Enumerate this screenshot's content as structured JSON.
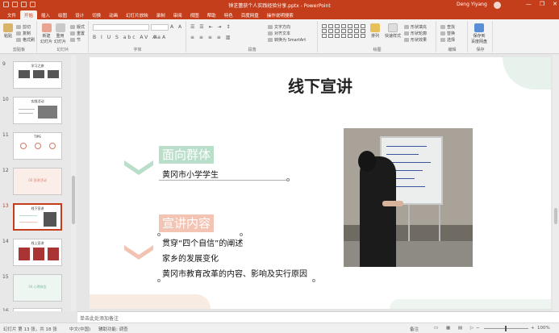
{
  "window": {
    "title": "钟芝蕾获个人实践经验分享.pptx  -  PowerPoint",
    "user": "Deng Yiyang",
    "min": "—",
    "restore": "❐",
    "close": "✕"
  },
  "tabs": [
    "文件",
    "开始",
    "插入",
    "绘图",
    "设计",
    "切换",
    "动画",
    "幻灯片放映",
    "录制",
    "审阅",
    "视图",
    "帮助",
    "特色",
    "百度网盘",
    "操作说明搜索"
  ],
  "ribbon": {
    "paste": "粘贴",
    "cut": "剪切",
    "copy": "复制",
    "format_painter": "格式刷",
    "new_slide": "新建\n幻灯片",
    "reuse_slide": "重用\n幻灯片",
    "layout": "版式",
    "reset": "重置",
    "section": "节",
    "text_direction": "文字方向",
    "align_text": "对齐文本",
    "smartart": "转换为 SmartArt",
    "arrange": "排列",
    "quick_styles": "快速样式",
    "shape_fill": "形状填充",
    "shape_outline": "形状轮廓",
    "shape_effects": "形状效果",
    "find": "查找",
    "replace": "替换",
    "select": "选择",
    "save_to_baidu": "保存到\n百度网盘",
    "group_labels": [
      "剪贴板",
      "幻灯片",
      "字体",
      "段落",
      "绘图",
      "编辑",
      "保存"
    ]
  },
  "thumbnails": [
    {
      "num": "9",
      "title": "学习之旅"
    },
    {
      "num": "10",
      "title": "实践活动"
    },
    {
      "num": "11",
      "title": "TIPS"
    },
    {
      "num": "12",
      "title": "03 宣讲活动"
    },
    {
      "num": "13",
      "title": "线下宣讲"
    },
    {
      "num": "14",
      "title": "线上宣讲"
    },
    {
      "num": "15",
      "title": "04 心得体会"
    },
    {
      "num": "16",
      "title": ""
    }
  ],
  "slide": {
    "title": "线下宣讲",
    "section1": {
      "label": "面向群体",
      "lines": [
        "黄冈市小学学生"
      ]
    },
    "section2": {
      "label": "宣讲内容",
      "lines": [
        "贯穿“四个自信”的阐述",
        "家乡的发展变化",
        "黄冈市教育改革的内容、影响及实行原因"
      ]
    }
  },
  "notes_placeholder": "单击此处添加备注",
  "status": {
    "slide_count": "幻灯片 第 13 张，共 18 张",
    "language": "中文(中国)",
    "accessibility": "辅助功能: 调查",
    "notes": "备注",
    "zoom": "100%"
  },
  "colors": {
    "accent": "#c43e1c",
    "green_label": "#b9dec9",
    "red_label": "#f3c3b3"
  }
}
